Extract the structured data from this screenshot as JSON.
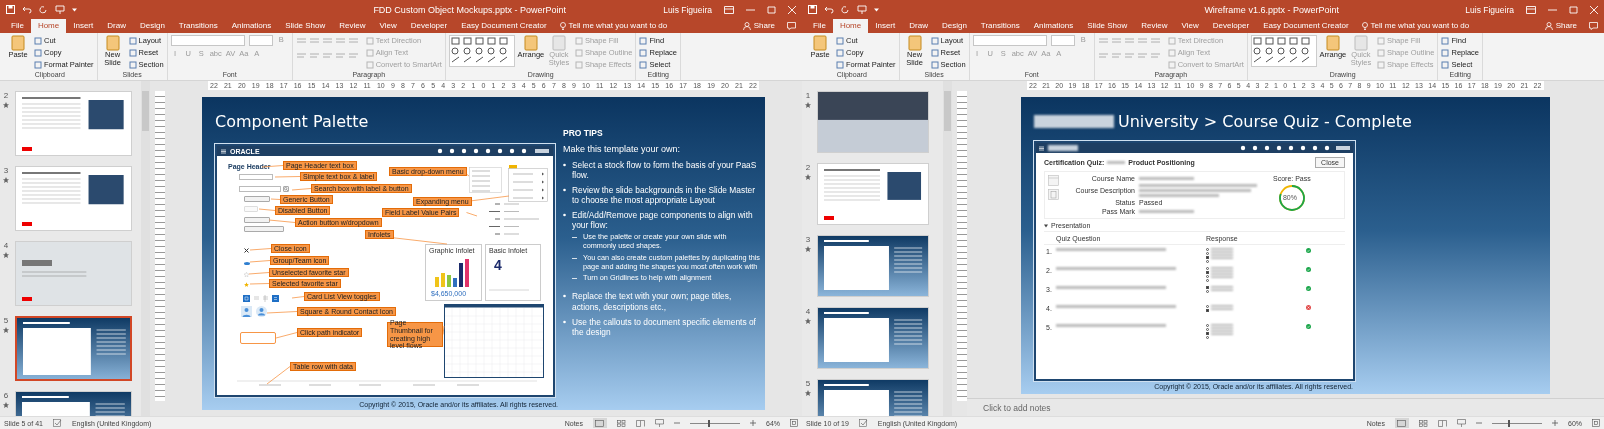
{
  "windows": [
    {
      "title": "FDD Custom Object Mockups.pptx - PowerPoint",
      "user": "Luis Figueira",
      "tell_me": "Tell me what you want to do",
      "share": "Share",
      "tabs": [
        {
          "label": "File",
          "selected": false
        },
        {
          "label": "Home",
          "selected": true
        },
        {
          "label": "Insert",
          "selected": false
        },
        {
          "label": "Draw",
          "selected": false
        },
        {
          "label": "Design",
          "selected": false
        },
        {
          "label": "Transitions",
          "selected": false
        },
        {
          "label": "Animations",
          "selected": false
        },
        {
          "label": "Slide Show",
          "selected": false
        },
        {
          "label": "Review",
          "selected": false
        },
        {
          "label": "View",
          "selected": false
        },
        {
          "label": "Developer",
          "selected": false
        },
        {
          "label": "Easy Document Creator",
          "selected": false
        }
      ],
      "ribbon": [
        {
          "label": "Clipboard",
          "kind": "clipboard",
          "items": [
            {
              "label": "Paste",
              "kind": "large",
              "disabled": false
            },
            {
              "label": "Cut",
              "kind": "small",
              "disabled": false
            },
            {
              "label": "Copy",
              "kind": "small",
              "disabled": false
            },
            {
              "label": "Format Painter",
              "kind": "small",
              "disabled": false
            }
          ]
        },
        {
          "label": "Slides",
          "kind": "slides",
          "items": [
            {
              "label": "New Slide",
              "kind": "large",
              "disabled": false
            },
            {
              "label": "Layout",
              "kind": "small",
              "disabled": false
            },
            {
              "label": "Reset",
              "kind": "small",
              "disabled": false
            },
            {
              "label": "Section",
              "kind": "small",
              "disabled": false
            }
          ]
        },
        {
          "label": "Font",
          "kind": "font",
          "items": [
            {
              "label": "B",
              "kind": "glyph",
              "disabled": true
            },
            {
              "label": "I",
              "kind": "glyph",
              "disabled": true
            },
            {
              "label": "U",
              "kind": "glyph",
              "disabled": true
            },
            {
              "label": "S",
              "kind": "glyph",
              "disabled": true
            },
            {
              "label": "abc",
              "kind": "glyph",
              "disabled": true
            },
            {
              "label": "AV",
              "kind": "glyph",
              "disabled": true
            },
            {
              "label": "Aa",
              "kind": "glyph",
              "disabled": true
            },
            {
              "label": "A",
              "kind": "glyph",
              "disabled": true
            }
          ]
        },
        {
          "label": "Paragraph",
          "kind": "paragraph",
          "items": [
            {
              "label": "Text Direction",
              "kind": "small",
              "disabled": true
            },
            {
              "label": "Align Text",
              "kind": "small",
              "disabled": true
            },
            {
              "label": "Convert to SmartArt",
              "kind": "small",
              "disabled": true
            }
          ]
        },
        {
          "label": "Drawing",
          "kind": "drawing",
          "items": [
            {
              "label": "Arrange",
              "kind": "large",
              "disabled": false
            },
            {
              "label": "Quick Styles",
              "kind": "large",
              "disabled": true
            },
            {
              "label": "Shape Fill",
              "kind": "small",
              "disabled": true
            },
            {
              "label": "Shape Outline",
              "kind": "small",
              "disabled": true
            },
            {
              "label": "Shape Effects",
              "kind": "small",
              "disabled": true
            }
          ]
        },
        {
          "label": "Editing",
          "kind": "editing",
          "items": [
            {
              "label": "Find",
              "kind": "small",
              "disabled": false
            },
            {
              "label": "Replace",
              "kind": "small",
              "disabled": false
            },
            {
              "label": "Select",
              "kind": "small",
              "disabled": false
            }
          ]
        }
      ],
      "ruler": [
        "22",
        "21",
        "20",
        "19",
        "18",
        "17",
        "16",
        "15",
        "14",
        "13",
        "12",
        "11",
        "10",
        "9",
        "8",
        "7",
        "6",
        "5",
        "4",
        "3",
        "2",
        "1",
        "0",
        "1",
        "2",
        "3",
        "4",
        "5",
        "6",
        "7",
        "8",
        "9",
        "10",
        "11",
        "12",
        "13",
        "14",
        "15",
        "16",
        "17",
        "18",
        "19",
        "20",
        "21",
        "22"
      ],
      "thumbnails": [
        {
          "number": "2",
          "kind": "light",
          "selected": false
        },
        {
          "number": "3",
          "kind": "light",
          "selected": false
        },
        {
          "number": "4",
          "kind": "section",
          "selected": false
        },
        {
          "number": "5",
          "kind": "dark",
          "selected": true
        },
        {
          "number": "6",
          "kind": "dark",
          "selected": false
        }
      ],
      "slide": {
        "kind": "palette",
        "title": "Component Palette",
        "mockup": {
          "brand": "ORACLE",
          "page_header": "Page Header",
          "graphic_infolet": {
            "title": "Graphic Infolet",
            "value": "$4,650,000"
          },
          "basic_infolet": {
            "title": "Basic Infolet",
            "value": "4"
          },
          "callouts": [
            "Page Header text box",
            "Simple text box & label",
            "Search box with label & button",
            "Generic Button",
            "Disabled Button",
            "Action button w/dropdown",
            "Infolets",
            "Close icon",
            "Group/Team icon",
            "Unselected favorite star",
            "Selected favorite star",
            "Card List View toggles",
            "Square & Round Contact Icon",
            "Click path indicator",
            "Table row with data",
            "Basic drop-down menu",
            "Expanding menu",
            "Field Label Value Pairs",
            "Page Thumbnail for creating high level flows"
          ]
        },
        "pro_tips": {
          "heading": "PRO TIPS",
          "intro": "Make this template your own:",
          "items": [
            {
              "text": "Select a stock flow to form the basis of your PaaS flow."
            },
            {
              "text": "Review the slide backgrounds in the Slide Master to choose the most appropriate Layout"
            },
            {
              "text": "Edit/Add/Remove page components to align with your flow:",
              "children": [
                {
                  "text": "Use the palette or create your own slide with commonly used shapes."
                },
                {
                  "text": "You can also create custom palettes by duplicating this page and adding the shapes you most often work with"
                },
                {
                  "text": "Turn on Gridlines to help with alignment"
                }
              ]
            },
            {
              "text": "Replace the text with your own; page titles, actions, descriptions etc.,"
            },
            {
              "text": "Use the callouts to document specific elements of the design"
            }
          ]
        },
        "copyright": "Copyright © 2015, Oracle and/or its affiliates. All rights reserved."
      },
      "status": {
        "slide_info": "Slide 5 of 41",
        "language": "English (United Kingdom)",
        "notes": "Notes",
        "zoom": "64%",
        "level": 0.38
      }
    },
    {
      "title": "Wireframe v1.6.pptx - PowerPoint",
      "user": "Luis Figueira",
      "tell_me": "Tell me what you want to do",
      "share": "Share",
      "tabs": [
        {
          "label": "File",
          "selected": false
        },
        {
          "label": "Home",
          "selected": true
        },
        {
          "label": "Insert",
          "selected": false
        },
        {
          "label": "Draw",
          "selected": false
        },
        {
          "label": "Design",
          "selected": false
        },
        {
          "label": "Transitions",
          "selected": false
        },
        {
          "label": "Animations",
          "selected": false
        },
        {
          "label": "Slide Show",
          "selected": false
        },
        {
          "label": "Review",
          "selected": false
        },
        {
          "label": "View",
          "selected": false
        },
        {
          "label": "Developer",
          "selected": false
        },
        {
          "label": "Easy Document Creator",
          "selected": false
        }
      ],
      "ribbon": [
        {
          "label": "Clipboard",
          "kind": "clipboard",
          "items": [
            {
              "label": "Paste",
              "kind": "large",
              "disabled": false
            },
            {
              "label": "Cut",
              "kind": "small",
              "disabled": false
            },
            {
              "label": "Copy",
              "kind": "small",
              "disabled": false
            },
            {
              "label": "Format Painter",
              "kind": "small",
              "disabled": false
            }
          ]
        },
        {
          "label": "Slides",
          "kind": "slides",
          "items": [
            {
              "label": "New Slide",
              "kind": "large",
              "disabled": false
            },
            {
              "label": "Layout",
              "kind": "small",
              "disabled": false
            },
            {
              "label": "Reset",
              "kind": "small",
              "disabled": false
            },
            {
              "label": "Section",
              "kind": "small",
              "disabled": false
            }
          ]
        },
        {
          "label": "Font",
          "kind": "font",
          "items": [
            {
              "label": "B",
              "kind": "glyph",
              "disabled": true
            },
            {
              "label": "I",
              "kind": "glyph",
              "disabled": true
            },
            {
              "label": "U",
              "kind": "glyph",
              "disabled": true
            },
            {
              "label": "S",
              "kind": "glyph",
              "disabled": true
            },
            {
              "label": "abc",
              "kind": "glyph",
              "disabled": true
            },
            {
              "label": "AV",
              "kind": "glyph",
              "disabled": true
            },
            {
              "label": "Aa",
              "kind": "glyph",
              "disabled": true
            },
            {
              "label": "A",
              "kind": "glyph",
              "disabled": true
            }
          ]
        },
        {
          "label": "Paragraph",
          "kind": "paragraph",
          "items": [
            {
              "label": "Text Direction",
              "kind": "small",
              "disabled": true
            },
            {
              "label": "Align Text",
              "kind": "small",
              "disabled": true
            },
            {
              "label": "Convert to SmartArt",
              "kind": "small",
              "disabled": true
            }
          ]
        },
        {
          "label": "Drawing",
          "kind": "drawing",
          "items": [
            {
              "label": "Arrange",
              "kind": "large",
              "disabled": false
            },
            {
              "label": "Quick Styles",
              "kind": "large",
              "disabled": true
            },
            {
              "label": "Shape Fill",
              "kind": "small",
              "disabled": true
            },
            {
              "label": "Shape Outline",
              "kind": "small",
              "disabled": true
            },
            {
              "label": "Shape Effects",
              "kind": "small",
              "disabled": true
            }
          ]
        },
        {
          "label": "Editing",
          "kind": "editing",
          "items": [
            {
              "label": "Find",
              "kind": "small",
              "disabled": false
            },
            {
              "label": "Replace",
              "kind": "small",
              "disabled": false
            },
            {
              "label": "Select",
              "kind": "small",
              "disabled": false
            }
          ]
        }
      ],
      "ruler": [
        "22",
        "21",
        "20",
        "19",
        "18",
        "17",
        "16",
        "15",
        "14",
        "13",
        "12",
        "11",
        "10",
        "9",
        "8",
        "7",
        "6",
        "5",
        "4",
        "3",
        "2",
        "1",
        "0",
        "1",
        "2",
        "3",
        "4",
        "5",
        "6",
        "7",
        "8",
        "9",
        "10",
        "11",
        "12",
        "13",
        "14",
        "15",
        "16",
        "17",
        "18",
        "19",
        "20",
        "21",
        "22"
      ],
      "thumbnails": [
        {
          "number": "1",
          "kind": "photo",
          "selected": false
        },
        {
          "number": "2",
          "kind": "light",
          "selected": false
        },
        {
          "number": "3",
          "kind": "dark",
          "selected": false
        },
        {
          "number": "4",
          "kind": "dark",
          "selected": false
        },
        {
          "number": "5",
          "kind": "dark",
          "selected": false
        }
      ],
      "slide": {
        "kind": "quiz",
        "title": "University > Course Quiz - Complete",
        "mockup": {
          "heading_label": "Certification Quiz:",
          "heading": "Product Positioning",
          "close": "Close",
          "fields": [
            {
              "label": "Course Name",
              "kind": "blurred"
            },
            {
              "label": "Course Description",
              "kind": "blurred-multi"
            },
            {
              "label": "Status",
              "kind": "text",
              "value": "Passed"
            },
            {
              "label": "Pass Mark",
              "kind": "blurred"
            }
          ],
          "score_label": "Score: Pass",
          "score": "80%",
          "level": 0.8,
          "section": "Presentation",
          "expanded": true,
          "columns": [
            "Quiz Question",
            "Response"
          ],
          "questions": [
            {
              "number": "1.",
              "correct": true,
              "options": [
                {
                  "selected": false
                },
                {
                  "selected": false
                },
                {
                  "selected": true
                },
                {
                  "selected": false
                }
              ]
            },
            {
              "number": "2.",
              "correct": true,
              "options": [
                {
                  "selected": false
                },
                {
                  "selected": true
                },
                {
                  "selected": false
                },
                {
                  "selected": false
                }
              ]
            },
            {
              "number": "3.",
              "correct": true,
              "options": [
                {
                  "selected": true
                },
                {
                  "selected": false
                }
              ]
            },
            {
              "number": "4.",
              "correct": false,
              "options": [
                {
                  "selected": false
                },
                {
                  "selected": true
                }
              ]
            },
            {
              "number": "5.",
              "correct": true,
              "options": [
                {
                  "selected": false
                },
                {
                  "selected": false
                },
                {
                  "selected": true
                },
                {
                  "selected": false
                }
              ]
            }
          ]
        },
        "copyright": "Copyright © 2015, Oracle and/or its affiliates. All rights reserved."
      },
      "notes_placeholder": "Click to add notes",
      "status": {
        "slide_info": "Slide 10 of 19",
        "language": "English (United Kingdom)",
        "notes": "Notes",
        "zoom": "60%",
        "level": 0.33
      }
    }
  ]
}
